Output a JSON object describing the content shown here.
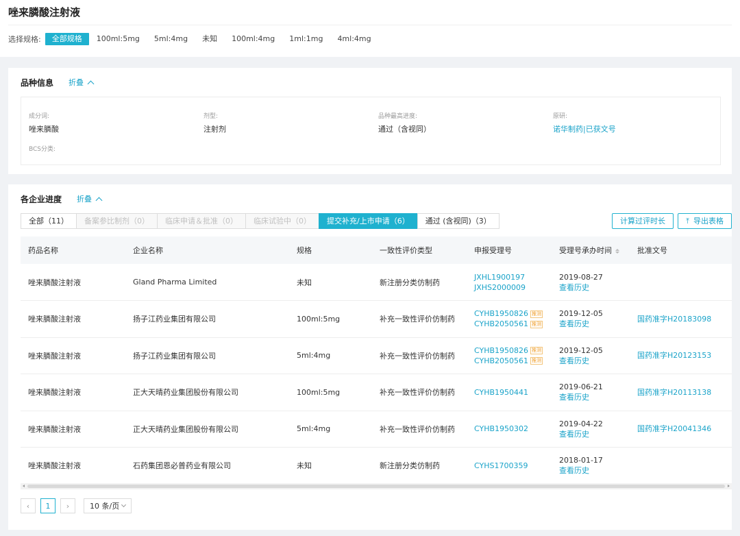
{
  "page": {
    "title": "唑来膦酸注射液"
  },
  "specs": {
    "label": "选择规格:",
    "items": [
      "全部规格",
      "100ml:5mg",
      "5ml:4mg",
      "未知",
      "100ml:4mg",
      "1ml:1mg",
      "4ml:4mg"
    ],
    "active_index": 0
  },
  "variety": {
    "title": "品种信息",
    "fold_label": "折叠",
    "fields": [
      {
        "label": "成分词:",
        "value": "唑来膦酸"
      },
      {
        "label": "剂型:",
        "value": "注射剂"
      },
      {
        "label": "品种最高进度:",
        "value": "通过（含视同）"
      },
      {
        "label": "原研:",
        "value": "诺华制药|已获文号"
      },
      {
        "label": "BCS分类:",
        "value": ""
      }
    ]
  },
  "progress": {
    "title": "各企业进度",
    "fold_label": "折叠",
    "tabs": [
      {
        "label": "全部（11）",
        "state": "normal"
      },
      {
        "label": "备案参比制剂（0）",
        "state": "disabled"
      },
      {
        "label": "临床申请＆批准（0）",
        "state": "disabled"
      },
      {
        "label": "临床试验中（0）",
        "state": "disabled"
      },
      {
        "label": "提交补充/上市申请（6）",
        "state": "active"
      },
      {
        "label": "通过 (含视同)（3）",
        "state": "normal"
      }
    ],
    "calc_button": "计算过评时长",
    "export_button": "导出表格",
    "columns": [
      "药品名称",
      "企业名称",
      "规格",
      "一致性评价类型",
      "申报受理号",
      "受理号承办时间",
      "批准文号"
    ],
    "rows": [
      {
        "drug": "唑来膦酸注射液",
        "company": "Gland Pharma Limited",
        "spec": "未知",
        "type": "新注册分类仿制药",
        "accepts": [
          {
            "no": "JXHL1900197",
            "tag": ""
          },
          {
            "no": "JXHS2000009",
            "tag": ""
          }
        ],
        "date": "2019-08-27",
        "history": "查看历史",
        "approval": ""
      },
      {
        "drug": "唑来膦酸注射液",
        "company": "扬子江药业集团有限公司",
        "spec": "100ml:5mg",
        "type": "补充一致性评价仿制药",
        "accepts": [
          {
            "no": "CYHB1950826",
            "tag": "推测"
          },
          {
            "no": "CYHB2050561",
            "tag": "推测"
          }
        ],
        "date": "2019-12-05",
        "history": "查看历史",
        "approval": "国药准字H20183098"
      },
      {
        "drug": "唑来膦酸注射液",
        "company": "扬子江药业集团有限公司",
        "spec": "5ml:4mg",
        "type": "补充一致性评价仿制药",
        "accepts": [
          {
            "no": "CYHB1950826",
            "tag": "推测"
          },
          {
            "no": "CYHB2050561",
            "tag": "推测"
          }
        ],
        "date": "2019-12-05",
        "history": "查看历史",
        "approval": "国药准字H20123153"
      },
      {
        "drug": "唑来膦酸注射液",
        "company": "正大天晴药业集团股份有限公司",
        "spec": "100ml:5mg",
        "type": "补充一致性评价仿制药",
        "accepts": [
          {
            "no": "CYHB1950441",
            "tag": ""
          }
        ],
        "date": "2019-06-21",
        "history": "查看历史",
        "approval": "国药准字H20113138"
      },
      {
        "drug": "唑来膦酸注射液",
        "company": "正大天晴药业集团股份有限公司",
        "spec": "5ml:4mg",
        "type": "补充一致性评价仿制药",
        "accepts": [
          {
            "no": "CYHB1950302",
            "tag": ""
          }
        ],
        "date": "2019-04-22",
        "history": "查看历史",
        "approval": "国药准字H20041346"
      },
      {
        "drug": "唑来膦酸注射液",
        "company": "石药集团恩必普药业有限公司",
        "spec": "未知",
        "type": "新注册分类仿制药",
        "accepts": [
          {
            "no": "CYHS1700359",
            "tag": ""
          }
        ],
        "date": "2018-01-17",
        "history": "查看历史",
        "approval": ""
      }
    ]
  },
  "pagination": {
    "prev": "‹",
    "next": "›",
    "current": "1",
    "page_size": "10 条/页"
  },
  "colors": {
    "accent": "#1fb1cf",
    "link": "#1aa3c9",
    "tag": "#f0a030"
  }
}
